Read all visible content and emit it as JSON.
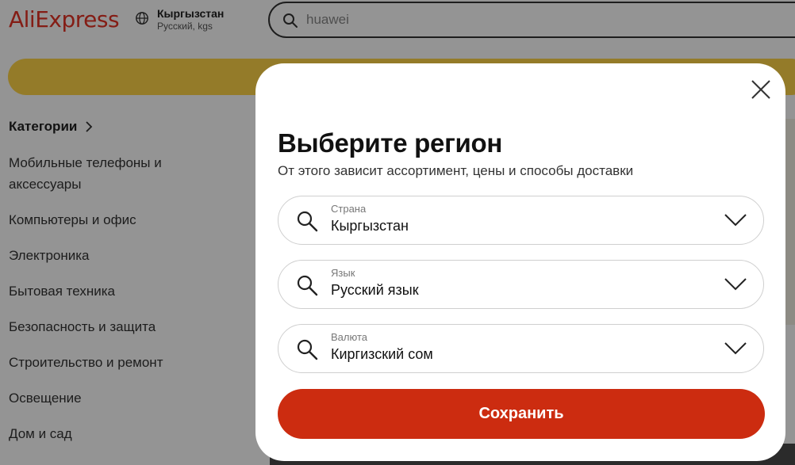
{
  "header": {
    "logo": "AliExpress",
    "region_country": "Кыргызстан",
    "region_lang_currency": "Русский, kgs",
    "search_value": "huawei"
  },
  "sidebar": {
    "heading": "Категории",
    "items": [
      "Мобильные телефоны и аксессуары",
      "Компьютеры и офис",
      "Электроника",
      "Бытовая техника",
      "Безопасность и защита",
      "Строительство и ремонт",
      "Освещение",
      "Дом и сад"
    ]
  },
  "modal": {
    "title": "Выберите регион",
    "subtitle": "От этого зависит ассортимент, цены и способы доставки",
    "fields": [
      {
        "label": "Страна",
        "value": "Кыргызстан"
      },
      {
        "label": "Язык",
        "value": "Русский язык"
      },
      {
        "label": "Валюта",
        "value": "Киргизский сом"
      }
    ],
    "save_label": "Сохранить"
  },
  "colors": {
    "brand": "#e43225",
    "save_button": "#cc2c10",
    "banner": "#ffd447"
  },
  "icons": [
    "globe-icon",
    "search-icon",
    "chevron-right-icon",
    "close-icon",
    "chevron-down-icon"
  ]
}
